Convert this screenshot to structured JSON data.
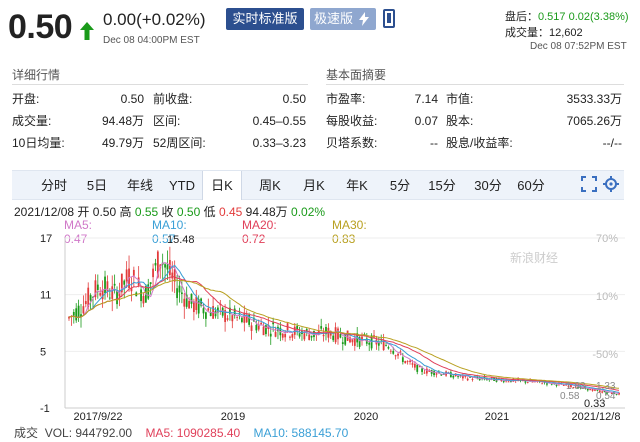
{
  "header": {
    "price": "0.50",
    "change": "0.00(+0.02%)",
    "timestamp": "Dec 08 04:00PM EST",
    "realtime_button": "实时标准版",
    "fast_button": "极速版",
    "after_hours_label": "盘后：",
    "after_hours_value": "0.517 0.02(3.38%)",
    "volume_label": "成交量：",
    "volume_value": "12,602",
    "after_hours_timestamp": "Dec 08 07:52PM EST",
    "colors": {
      "up": "#1a9a1a",
      "brand": "#2c4f8f"
    }
  },
  "detail": {
    "title": "详细行情",
    "rows": [
      [
        {
          "label": "开盘:",
          "value": "0.50"
        },
        {
          "label": "前收盘:",
          "value": "0.50"
        }
      ],
      [
        {
          "label": "成交量:",
          "value": "94.48万"
        },
        {
          "label": "区间:",
          "value": "0.45–0.55"
        }
      ],
      [
        {
          "label": "10日均量:",
          "value": "49.79万"
        },
        {
          "label": "52周区间:",
          "value": "0.33–3.23"
        }
      ]
    ]
  },
  "fundamentals": {
    "title": "基本面摘要",
    "rows": [
      [
        {
          "label": "市盈率:",
          "value": "7.14"
        },
        {
          "label": "市值:",
          "value": "3533.33万"
        }
      ],
      [
        {
          "label": "每股收益:",
          "value": "0.07"
        },
        {
          "label": "股本:",
          "value": "7065.26万"
        }
      ],
      [
        {
          "label": "贝塔系数:",
          "value": "--"
        },
        {
          "label": "股息/收益率:",
          "value": "--/--"
        }
      ]
    ]
  },
  "tabs": [
    "分时",
    "5日",
    "年线",
    "YTD",
    "日K",
    "周K",
    "月K",
    "年K",
    "5分",
    "15分",
    "30分",
    "60分"
  ],
  "active_tab": "日K",
  "ohlc": {
    "date": "2021/12/08",
    "open_label": "开",
    "open": "0.50",
    "high_label": "高",
    "high": "0.55",
    "close_label": "收",
    "close": "0.50",
    "low_label": "低",
    "low": "0.45",
    "volume": "94.48万",
    "change_pct": "0.02%"
  },
  "ma": [
    {
      "text": "MA5: 0.47",
      "color": "#d078c8"
    },
    {
      "text": "MA10: 0.57",
      "color": "#3a9fd6"
    },
    {
      "text": "MA20: 0.72",
      "color": "#e0405a"
    },
    {
      "text": "MA30: 0.83",
      "color": "#b8a020"
    }
  ],
  "bottom": {
    "label": "成交",
    "vol": "VOL: 944792.00",
    "ma5": "MA5: 1090285.40",
    "ma10": "MA10: 588145.70",
    "colors": {
      "vol": "#444",
      "ma5": "#e0405a",
      "ma10": "#3a9fd6"
    }
  },
  "chart_data": {
    "type": "line",
    "y_ticks": [
      "17",
      "11",
      "5",
      "-1"
    ],
    "pct_ticks": [
      "70%",
      "10%",
      "-50%"
    ],
    "x_ticks": [
      "2017/9/22",
      "2019",
      "2020",
      "2021",
      "2021/12/8"
    ],
    "peak_label": "15.48",
    "min_label": "0.33",
    "right_labels": [
      "1.83",
      "1.33",
      "0.58",
      "0.54"
    ],
    "watermark": "新浪财经",
    "ylim": [
      -1,
      17
    ],
    "series": [
      {
        "color": "#e0405a",
        "values": [
          8.5,
          10,
          12,
          11,
          13,
          11,
          15,
          12,
          10,
          9.5,
          9,
          8.5,
          8,
          7.5,
          7.3,
          7,
          6.8,
          7,
          6.5,
          6.2,
          6,
          5.6,
          4,
          3,
          2.8,
          2.5,
          2.2,
          2.1,
          2,
          1.9,
          1.8,
          1.7,
          1.5,
          1.3,
          1,
          0.7,
          0.5
        ]
      }
    ]
  }
}
